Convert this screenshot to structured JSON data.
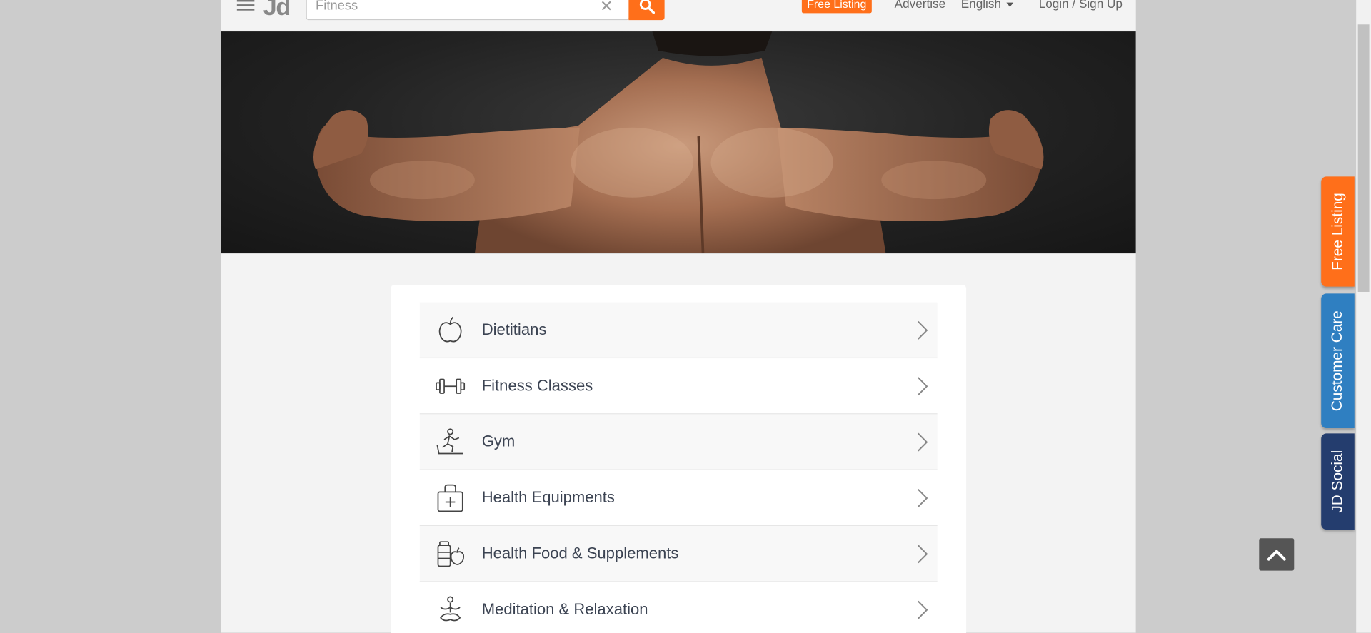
{
  "header": {
    "logo": "Jd",
    "search": {
      "value": "Fitness",
      "placeholder": "Fitness"
    },
    "free_listing": "Free Listing",
    "advertise": "Advertise",
    "language": "English",
    "login": "Login / Sign Up"
  },
  "categories": [
    {
      "label": "Dietitians",
      "icon": "apple-icon"
    },
    {
      "label": "Fitness Classes",
      "icon": "dumbbell-icon"
    },
    {
      "label": "Gym",
      "icon": "treadmill-runner-icon"
    },
    {
      "label": "Health Equipments",
      "icon": "medical-bag-icon"
    },
    {
      "label": "Health Food & Supplements",
      "icon": "supplements-icon"
    },
    {
      "label": "Meditation & Relaxation",
      "icon": "meditation-icon"
    }
  ],
  "side_tabs": {
    "free_listing": "Free Listing",
    "customer_care": "Customer Care",
    "jd_social": "JD Social"
  },
  "colors": {
    "accent_orange": "#ff6f1a",
    "customer_care_blue": "#2f7fc1",
    "jd_social_navy": "#243d6e"
  }
}
